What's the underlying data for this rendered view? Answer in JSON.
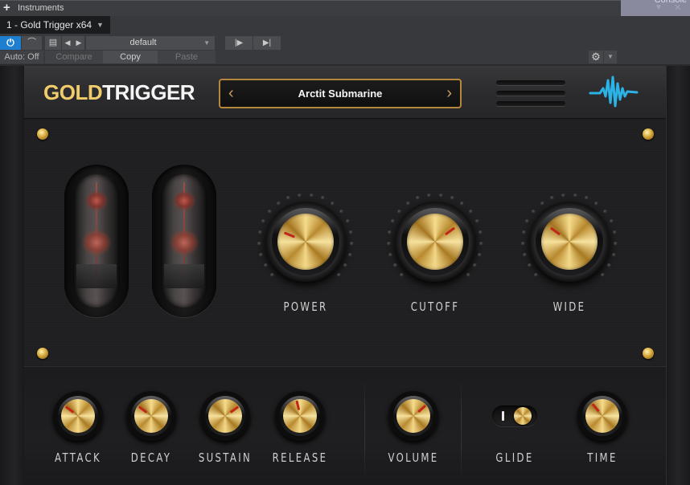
{
  "host": {
    "panel_title": "Instruments",
    "instrument_tab": "1 - Gold Trigger x64",
    "ghost_window_text": "Console",
    "toolbar": {
      "power_icon": "power-icon",
      "automation_icon": "automation-icon",
      "preset_doc_icon": "document-icon",
      "prev_icon": "◀",
      "next_icon": "▶",
      "preset_value": "default",
      "route_in_icon": "route-in-icon",
      "route_out_icon": "route-out-icon",
      "auto_label": "Auto: Off",
      "compare_label": "Compare",
      "copy_label": "Copy",
      "paste_label": "Paste",
      "settings_icon": "gear-icon"
    }
  },
  "plugin": {
    "logo": {
      "part1": "GOLD",
      "part2": "TRIGGER"
    },
    "preset": {
      "name": "Arctit Submarine",
      "prev": "‹",
      "next": "›"
    },
    "brand_color": "#f0cc6a",
    "accent_blue": "#2bb3e6",
    "indicator_color": "#c1261a",
    "main_knobs": [
      {
        "label": "POWER",
        "value": 0.25
      },
      {
        "label": "CUTOFF",
        "value": 0.7
      },
      {
        "label": "WIDE",
        "value": 0.3
      }
    ],
    "envelope_knobs": [
      {
        "label": "ATTACK",
        "value": 0.3
      },
      {
        "label": "DECAY",
        "value": 0.3
      },
      {
        "label": "SUSTAIN",
        "value": 0.7
      },
      {
        "label": "RELEASE",
        "value": 0.45
      }
    ],
    "volume_knob": {
      "label": "VOLUME",
      "value": 0.68
    },
    "glide": {
      "label": "GLIDE",
      "state": "on"
    },
    "time_knob": {
      "label": "TIME",
      "value": 0.35
    }
  }
}
